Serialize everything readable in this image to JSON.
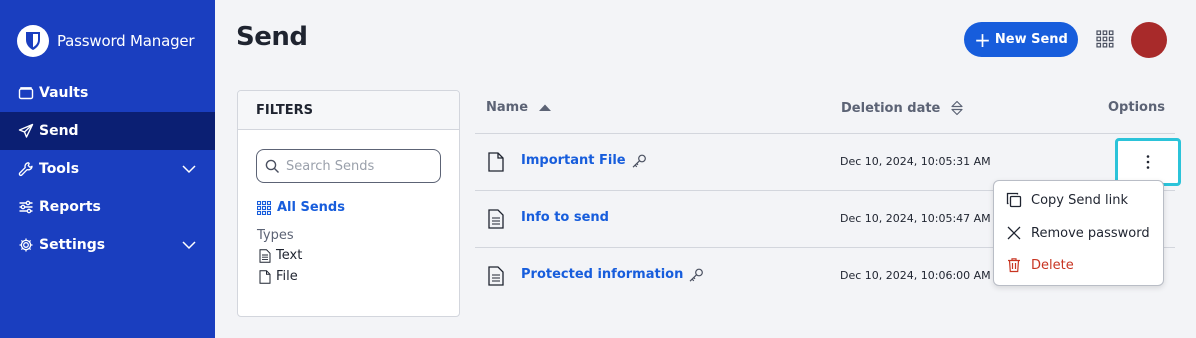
{
  "brand": {
    "name": "Password Manager"
  },
  "sidebar": {
    "items": [
      {
        "label": "Vaults",
        "icon": "vault-icon"
      },
      {
        "label": "Send",
        "icon": "paper-plane-icon",
        "active": true
      },
      {
        "label": "Tools",
        "icon": "wrench-icon",
        "expandable": true
      },
      {
        "label": "Reports",
        "icon": "sliders-icon"
      },
      {
        "label": "Settings",
        "icon": "gear-icon",
        "expandable": true
      }
    ]
  },
  "header": {
    "title": "Send",
    "new_send_label": "New Send"
  },
  "filters": {
    "title": "FILTERS",
    "search_placeholder": "Search Sends",
    "all_sends": "All Sends",
    "types_label": "Types",
    "types": [
      "Text",
      "File"
    ]
  },
  "table": {
    "columns": {
      "name": "Name",
      "deletion_date": "Deletion date",
      "options": "Options"
    },
    "rows": [
      {
        "name": "Important File",
        "type": "file",
        "protected": true,
        "deletion_date": "Dec 10, 2024, 10:05:31 AM"
      },
      {
        "name": "Info to send",
        "type": "text",
        "protected": false,
        "deletion_date": "Dec 10, 2024, 10:05:47 AM"
      },
      {
        "name": "Protected information",
        "type": "text",
        "protected": true,
        "deletion_date": "Dec 10, 2024, 10:06:00 AM"
      }
    ]
  },
  "menu": {
    "items": [
      {
        "label": "Copy Send link",
        "icon": "copy-icon"
      },
      {
        "label": "Remove password",
        "icon": "close-icon"
      },
      {
        "label": "Delete",
        "icon": "trash-icon",
        "danger": true
      }
    ]
  },
  "colors": {
    "sidebar": "#1a3ebf",
    "sidebar_active": "#0b1f73",
    "primary": "#175ddc",
    "focus": "#2bc3d9",
    "danger": "#c83522",
    "avatar": "#a82a2a"
  }
}
